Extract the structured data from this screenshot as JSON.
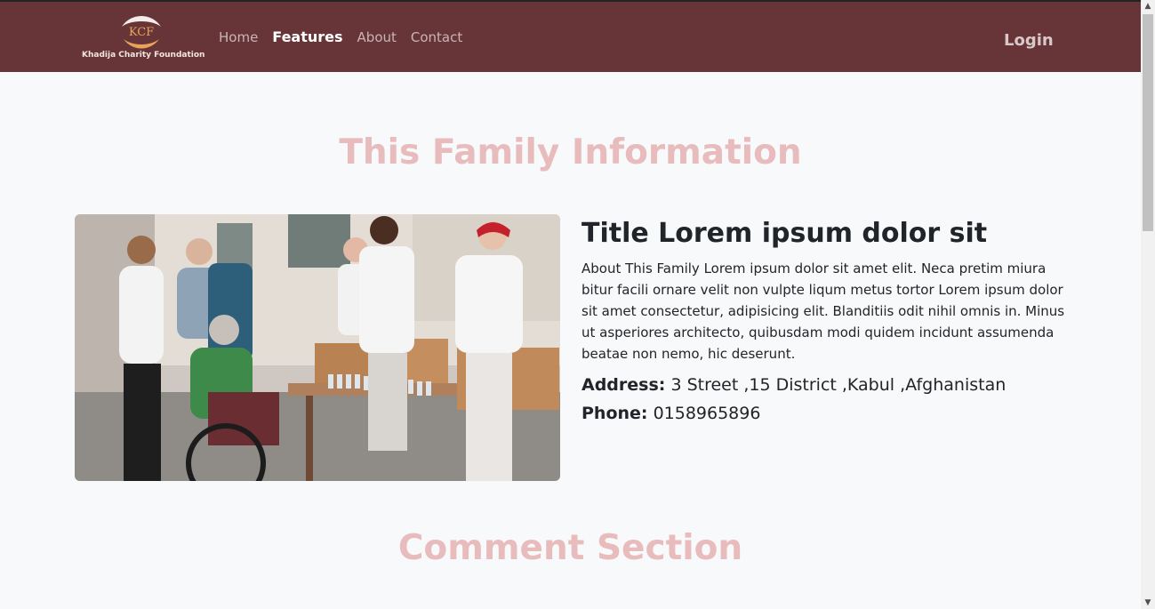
{
  "brand": {
    "logo_text": "KCF",
    "name": "Khadija Charity Foundation",
    "colors": {
      "navbar": "#673538",
      "heading": "#e8bcbd",
      "logo": "#e8a35a"
    }
  },
  "nav": {
    "items": [
      {
        "label": "Home",
        "active": false
      },
      {
        "label": "Features",
        "active": true
      },
      {
        "label": "About",
        "active": false
      },
      {
        "label": "Contact",
        "active": false
      }
    ],
    "login_label": "Login"
  },
  "section": {
    "heading": "This Family Information",
    "photo_description": "volunteers-handing-out-food-image",
    "title": "Title Lorem ipsum dolor sit",
    "about": "About This Family Lorem ipsum dolor sit amet elit. Neca pretim miura bitur facili ornare velit non vulpte liqum metus tortor Lorem ipsum dolor sit amet consectetur, adipisicing elit. Blanditiis odit nihil omnis in. Minus ut asperiores architecto, quibusdam modi quidem incidunt assumenda beatae non nemo, hic deserunt.",
    "address_label": "Address:",
    "address_value": "3 Street ,15 District ,Kabul ,Afghanistan",
    "phone_label": "Phone:",
    "phone_value": "0158965896"
  },
  "comments": {
    "heading": "Comment Section"
  },
  "icons": {
    "scroll_up": "chevron-up-icon",
    "scroll_down": "chevron-down-icon"
  }
}
